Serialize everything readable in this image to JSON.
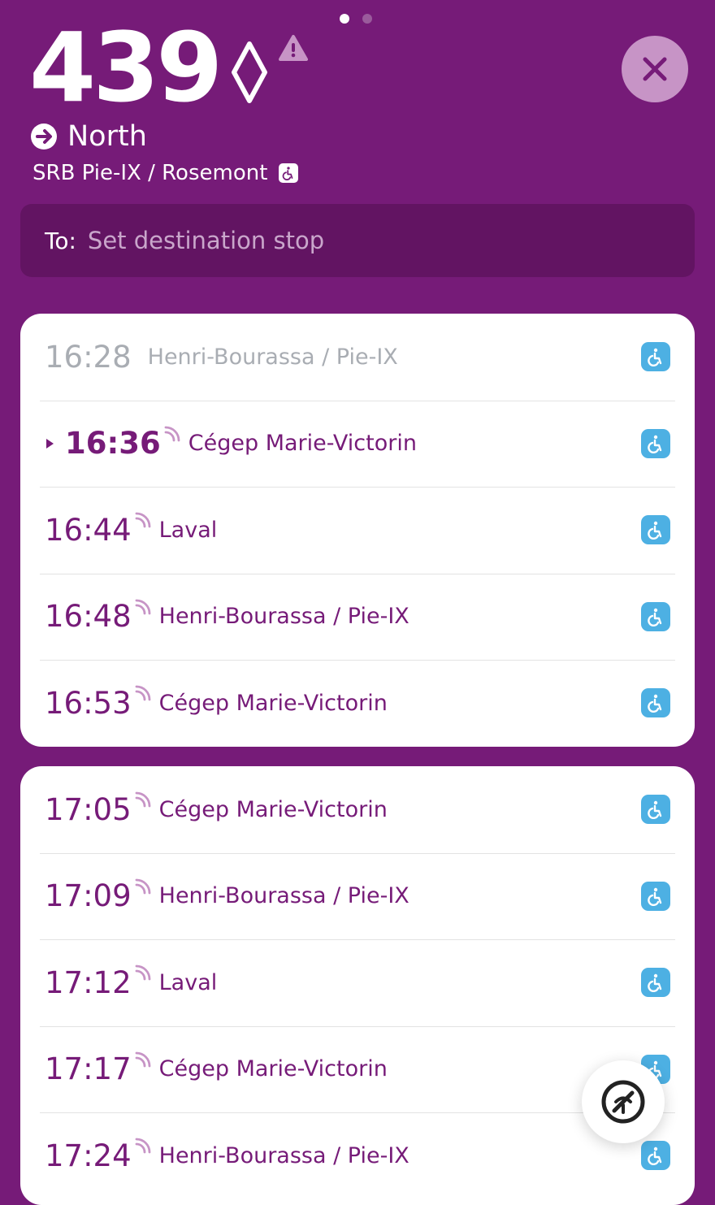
{
  "pager": {
    "count": 2,
    "active": 0
  },
  "header": {
    "route_number": "439",
    "direction": "North",
    "stop_name": "SRB Pie-IX / Rosemont"
  },
  "destination": {
    "label": "To:",
    "placeholder": "Set destination stop"
  },
  "colors": {
    "background": "#761b78",
    "accent_text": "#761b78",
    "past_text": "#a9adb3",
    "wheelchair_badge": "#4db0e3"
  },
  "icons": {
    "route_type": "diamond-icon",
    "alert": "alert-triangle-icon",
    "close": "close-icon",
    "direction": "arrow-right-circle-icon",
    "accessible": "wheelchair-icon",
    "realtime": "realtime-signal-icon",
    "fab": "no-bus-icon"
  },
  "schedule_groups": [
    [
      {
        "time": "16:28",
        "destination": "Henri-Bourassa / Pie-IX",
        "past": true,
        "realtime": false,
        "next": false
      },
      {
        "time": "16:36",
        "destination": "Cégep Marie-Victorin",
        "past": false,
        "realtime": true,
        "next": true
      },
      {
        "time": "16:44",
        "destination": "Laval",
        "past": false,
        "realtime": true,
        "next": false
      },
      {
        "time": "16:48",
        "destination": "Henri-Bourassa / Pie-IX",
        "past": false,
        "realtime": true,
        "next": false
      },
      {
        "time": "16:53",
        "destination": "Cégep Marie-Victorin",
        "past": false,
        "realtime": true,
        "next": false
      }
    ],
    [
      {
        "time": "17:05",
        "destination": "Cégep Marie-Victorin",
        "past": false,
        "realtime": true,
        "next": false
      },
      {
        "time": "17:09",
        "destination": "Henri-Bourassa / Pie-IX",
        "past": false,
        "realtime": true,
        "next": false
      },
      {
        "time": "17:12",
        "destination": "Laval",
        "past": false,
        "realtime": true,
        "next": false
      },
      {
        "time": "17:17",
        "destination": "Cégep Marie-Victorin",
        "past": false,
        "realtime": true,
        "next": false
      },
      {
        "time": "17:24",
        "destination": "Henri-Bourassa / Pie-IX",
        "past": false,
        "realtime": true,
        "next": false
      }
    ]
  ]
}
